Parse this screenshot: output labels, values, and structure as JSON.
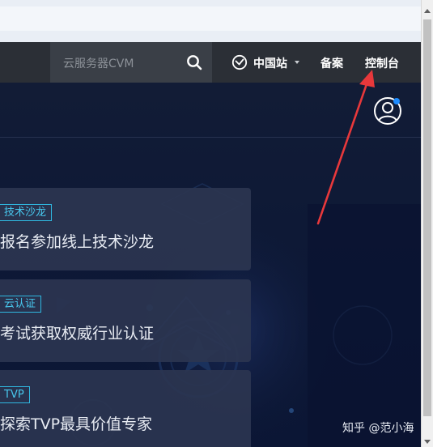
{
  "navbar": {
    "search_placeholder": "云服务器CVM",
    "site_label": "中国站",
    "beian_label": "备案",
    "console_label": "控制台"
  },
  "cards": [
    {
      "tag": "技术沙龙",
      "title": "报名参加线上技术沙龙"
    },
    {
      "tag": "云认证",
      "title": "考试获取权威行业认证"
    },
    {
      "tag": "TVP",
      "title": "探索TVP最具价值专家"
    }
  ],
  "watermark": "知乎 @范小海",
  "icons": {
    "search": "search-icon",
    "site": "globe-clock-icon",
    "avatar": "user-avatar-icon"
  },
  "colors": {
    "navbar_bg": "#2b2f36",
    "hero_bg": "#0f1a36",
    "tag_border": "#2fb8e0",
    "annotation_arrow": "#e8383b",
    "notification_dot": "#1e8cff"
  }
}
